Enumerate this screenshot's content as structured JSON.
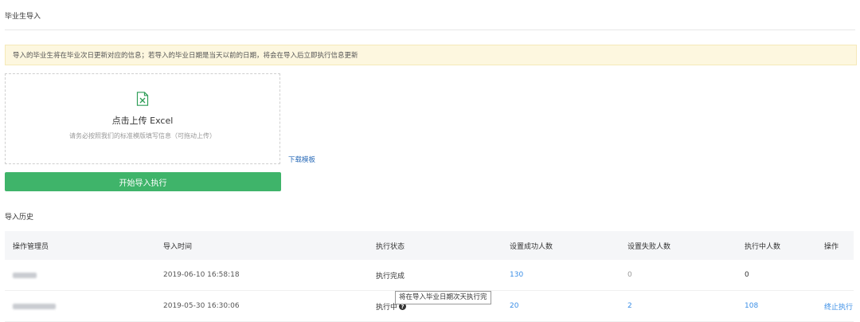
{
  "page": {
    "title": "毕业生导入"
  },
  "notice": {
    "text": "导入的毕业生将在毕业次日更新对应的信息；若导入的毕业日期是当天以前的日期，将会在导入后立即执行信息更新"
  },
  "upload": {
    "icon": "excel-file-icon",
    "title": "点击上传 Excel",
    "hint": "请务必按照我们的标准模版填写信息（可拖动上传）",
    "download_label": "下载模板",
    "start_label": "开始导入执行"
  },
  "history": {
    "title": "导入历史",
    "columns": [
      "操作管理员",
      "导入时间",
      "执行状态",
      "设置成功人数",
      "设置失败人数",
      "执行中人数",
      "操作"
    ],
    "rows": [
      {
        "time": "2019-06-10 16:58:18",
        "status": "执行完成",
        "success": "130",
        "failed": "0",
        "running": "0",
        "action": ""
      },
      {
        "time": "2019-05-30 16:30:06",
        "status": "执行中",
        "success": "20",
        "failed": "2",
        "running": "108",
        "action": "终止执行"
      }
    ],
    "tooltip": "将在导入毕业日期次天执行完"
  },
  "colors": {
    "accent": "#3fb46a",
    "link": "#3a8ee6",
    "notice_bg": "#fdf7df"
  }
}
